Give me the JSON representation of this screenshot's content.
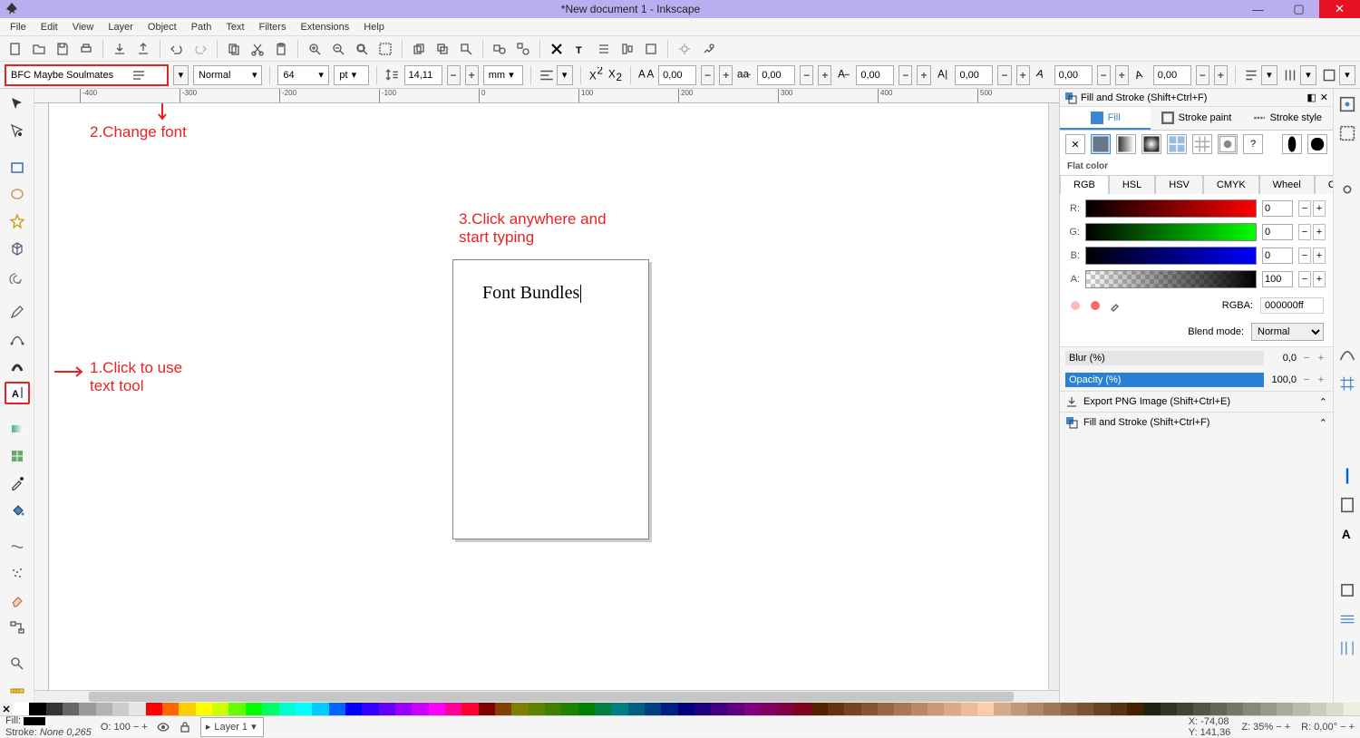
{
  "window": {
    "title": "*New document 1 - Inkscape"
  },
  "menu": [
    "File",
    "Edit",
    "View",
    "Layer",
    "Object",
    "Path",
    "Text",
    "Filters",
    "Extensions",
    "Help"
  ],
  "tooloptions": {
    "font": "BFC Maybe Soulmates",
    "style": "Normal",
    "size": "64",
    "sizeunit": "pt",
    "lineheight": "14,11",
    "lhunit": "mm",
    "k1": "0,00",
    "k2": "0,00",
    "k3": "0,00",
    "k4": "0,00",
    "k5": "0,00",
    "k6": "0,00"
  },
  "annotations": {
    "a1": "1.Click to use\ntext tool",
    "a2": "2.Change font",
    "a3": "3.Click anywhere and\nstart typing"
  },
  "canvas": {
    "typed_text": "Font Bundles"
  },
  "ruler_ticks": [
    "-400",
    "-300",
    "-200",
    "-100",
    "0",
    "100",
    "200",
    "300",
    "400",
    "500"
  ],
  "panel": {
    "hdr": "Fill and Stroke (Shift+Ctrl+F)",
    "tabs": {
      "fill": "Fill",
      "strokepaint": "Stroke paint",
      "strokestyle": "Stroke style"
    },
    "flat": "Flat color",
    "modes": [
      "RGB",
      "HSL",
      "HSV",
      "CMYK",
      "Wheel",
      "CMS"
    ],
    "r_label": "R:",
    "g_label": "G:",
    "b_label": "B:",
    "a_label": "A:",
    "r": "0",
    "g": "0",
    "b": "0",
    "a": "100",
    "rgba_label": "RGBA:",
    "rgba": "000000ff",
    "blend_label": "Blend mode:",
    "blend": "Normal",
    "blur_label": "Blur (%)",
    "blur_val": "0,0",
    "opac_label": "Opacity (%)",
    "opac_val": "100,0",
    "dock1": "Export PNG Image (Shift+Ctrl+E)",
    "dock2": "Fill and Stroke (Shift+Ctrl+F)"
  },
  "status": {
    "fill_label": "Fill:",
    "stroke_label": "Stroke:",
    "stroke_val": "None 0,265",
    "o_label": "O:",
    "o_val": "100",
    "layer": "Layer 1",
    "x_label": "X:",
    "x": "-74,08",
    "y_label": "Y:",
    "y": "141,36",
    "z_label": "Z:",
    "z": "35%",
    "r_label": "R:",
    "r": "0,00°"
  },
  "palette_colors": [
    "#ffffff",
    "#000000",
    "#333333",
    "#666666",
    "#999999",
    "#b3b3b3",
    "#cccccc",
    "#e6e6e6",
    "#ff0000",
    "#ff6600",
    "#ffcc00",
    "#ffff00",
    "#ccff00",
    "#66ff00",
    "#00ff00",
    "#00ff66",
    "#00ffcc",
    "#00ffff",
    "#00ccff",
    "#0066ff",
    "#0000ff",
    "#3300ff",
    "#6600ff",
    "#9900ff",
    "#cc00ff",
    "#ff00ff",
    "#ff0099",
    "#ff0033",
    "#800000",
    "#804000",
    "#808000",
    "#608000",
    "#408000",
    "#208000",
    "#008000",
    "#008040",
    "#008080",
    "#006080",
    "#004080",
    "#002080",
    "#000080",
    "#200080",
    "#400080",
    "#600080",
    "#800080",
    "#800060",
    "#800040",
    "#800020",
    "#552200",
    "#663311",
    "#774422",
    "#885533",
    "#996644",
    "#aa7755",
    "#bb8866",
    "#cc9977",
    "#ddaa88",
    "#eebb99",
    "#ffccaa",
    "#d4aa88",
    "#c29977",
    "#b08866",
    "#9e7755",
    "#8c6644",
    "#7a5533",
    "#684422",
    "#563311",
    "#442200",
    "#222211",
    "#333322",
    "#444433",
    "#555544",
    "#666655",
    "#777766",
    "#888877",
    "#999988",
    "#aaaa99",
    "#bbbbaa",
    "#ccccbb",
    "#ddddcc",
    "#eeeedd"
  ]
}
